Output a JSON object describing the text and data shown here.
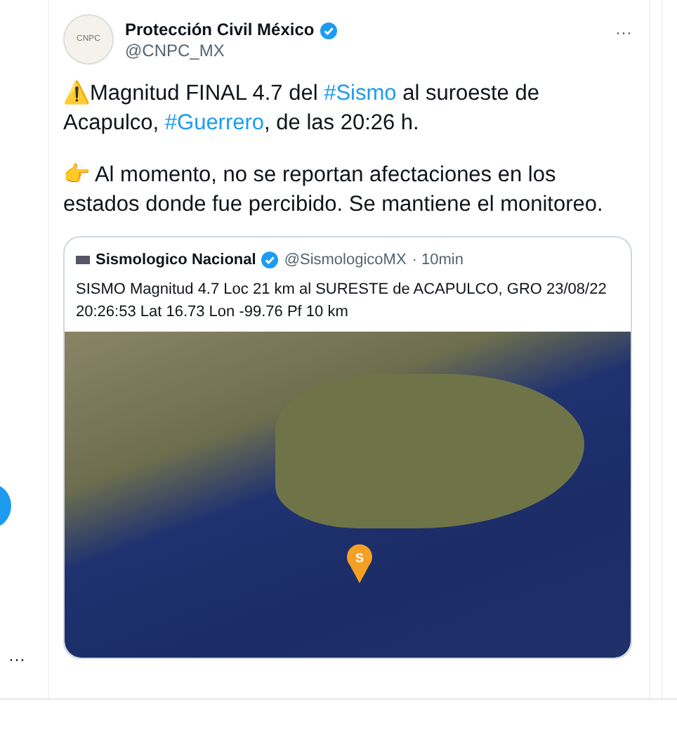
{
  "tweet": {
    "author": {
      "name": "Protección Civil México",
      "handle": "@CNPC_MX",
      "verified": true,
      "avatar_text": "CNPC"
    },
    "paragraphs": [
      [
        {
          "kind": "plain",
          "text": "⚠️Magnitud FINAL 4.7 del "
        },
        {
          "kind": "hashtag",
          "text": "#Sismo"
        },
        {
          "kind": "plain",
          "text": " al suroeste de Acapulco, "
        },
        {
          "kind": "hashtag",
          "text": "#Guerrero"
        },
        {
          "kind": "plain",
          "text": ", de las 20:26 h."
        }
      ],
      [
        {
          "kind": "plain",
          "text": "👉 Al momento, no se reportan afectaciones en los estados donde fue percibido. Se mantiene el monitoreo."
        }
      ]
    ],
    "more": "···",
    "quote": {
      "name": "Sismologico Nacional",
      "verified": true,
      "handle": "@SismologicoMX",
      "time": "· 10min",
      "text": "SISMO Magnitud 4.7 Loc  21 km al SURESTE de ACAPULCO, GRO 23/08/22 20:26:53 Lat 16.73 Lon -99.76 Pf 10 km",
      "marker": "S"
    }
  },
  "sidebar": {
    "more": "···"
  }
}
